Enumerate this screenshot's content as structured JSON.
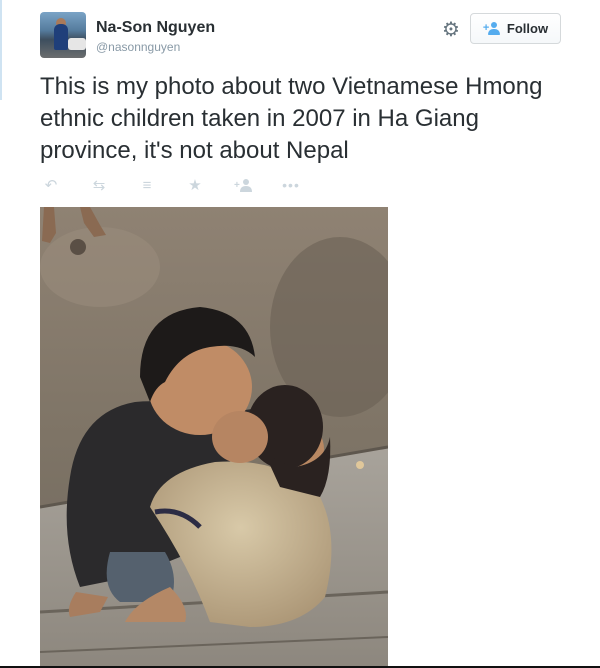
{
  "tweet": {
    "author_name": "Na-Son Nguyen",
    "author_handle": "@nasonnguyen",
    "text": "This is my photo about two Vietnamese Hmong ethnic children taken in 2007 in Ha Giang province, it's not about Nepal",
    "follow_label": "Follow",
    "icons": {
      "settings": "gear-icon",
      "follow": "add-user-icon",
      "reply": "reply-icon",
      "retweet": "retweet-icon",
      "buffer": "buffer-stack-icon",
      "favorite": "star-icon",
      "follow_action": "add-user-icon",
      "more": "more-dots-icon"
    }
  },
  "colors": {
    "text": "#292f33",
    "muted": "#8899a6",
    "action_icon": "#ccd6dd",
    "accent": "#55acee"
  }
}
